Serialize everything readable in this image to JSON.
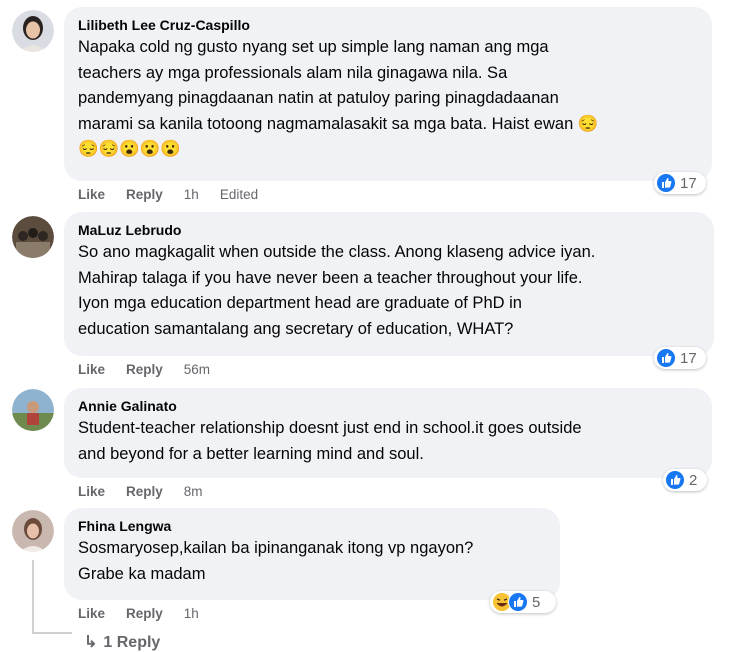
{
  "comments": [
    {
      "author": "Lilibeth Lee Cruz-Caspillo",
      "lines": [
        "Napaka cold ng gusto nyang set up simple lang naman ang mga",
        "teachers ay mga professionals alam nila ginagawa nila. Sa",
        "pandemyang pinagdaanan natin at patuloy paring pinagdadaanan",
        "marami sa kanila totoong nagmamalasakit sa mga bata. Haist ewan 😔"
      ],
      "emoji_line": "😔😔😮😮😮",
      "like": "Like",
      "reply": "Reply",
      "time": "1h",
      "edited": "Edited",
      "reaction_count": "17"
    },
    {
      "author": "MaLuz Lebrudo",
      "lines": [
        "So ano magkagalit when outside the class. Anong klaseng advice iyan.",
        "Mahirap talaga if you have never been a teacher throughout your life.",
        "Iyon mga education department head are graduate of PhD in",
        "education samantalang ang secretary of education, WHAT?"
      ],
      "like": "Like",
      "reply": "Reply",
      "time": "56m",
      "reaction_count": "17"
    },
    {
      "author": "Annie Galinato",
      "lines": [
        "Student-teacher relationship doesnt just end in school.it goes outside",
        "and beyond for a better learning mind and soul."
      ],
      "like": "Like",
      "reply": "Reply",
      "time": "8m",
      "reaction_count": "2"
    },
    {
      "author": "Fhina Lengwa",
      "lines": [
        "Sosmaryosep,kailan ba ipinanganak itong vp ngayon?",
        "Grabe ka madam"
      ],
      "like": "Like",
      "reply": "Reply",
      "time": "1h",
      "reaction_count": "5"
    }
  ],
  "view_replies": "1 Reply",
  "colors": {
    "like_blue": "#1877f2",
    "bubble": "#f0f2f5",
    "meta": "#65676b"
  }
}
